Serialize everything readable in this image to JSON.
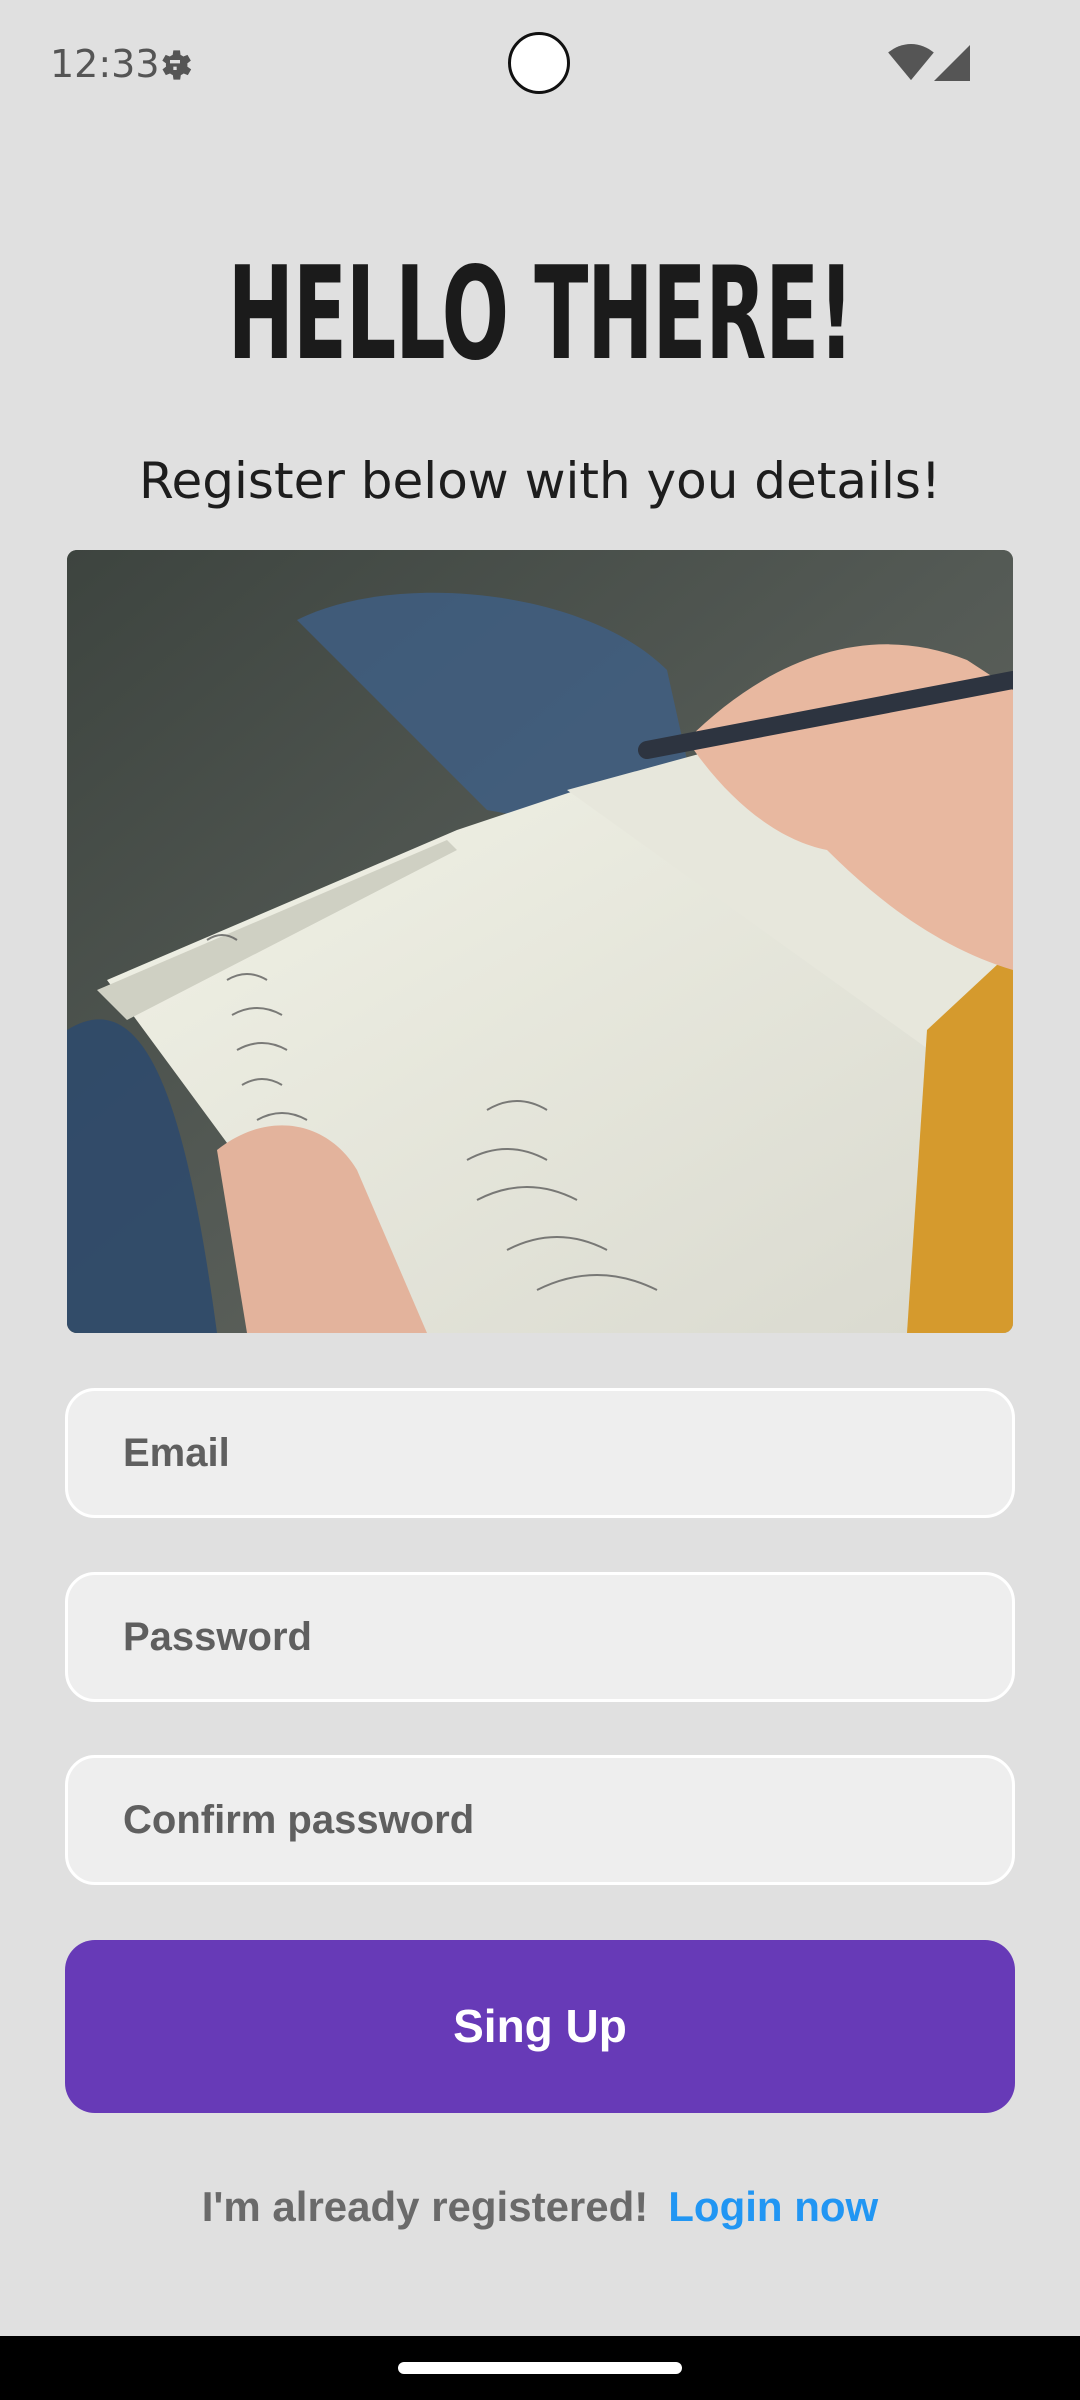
{
  "status_bar": {
    "time": "12:33"
  },
  "header": {
    "title": "HELLO THERE!",
    "subtitle": "Register below with you details!"
  },
  "form": {
    "email_placeholder": "Email",
    "password_placeholder": "Password",
    "confirm_placeholder": "Confirm password",
    "submit_label": "Sing Up"
  },
  "footer": {
    "prompt": "I'm already registered!",
    "link": "Login now"
  },
  "colors": {
    "background": "#e0e0e0",
    "primary": "#673ab7",
    "link": "#2196f3"
  }
}
